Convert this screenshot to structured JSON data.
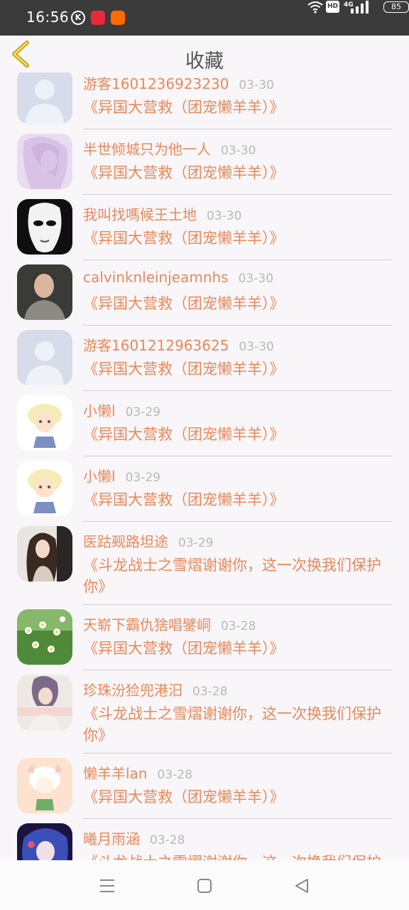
{
  "status_bar": {
    "time": "16:56",
    "battery": "85",
    "hd": "HD",
    "network": "4G"
  },
  "header": {
    "title": "收藏"
  },
  "items": [
    {
      "name": "游客1601236923230",
      "date": "03-30",
      "book": "《异国大营救（团宠懒羊羊）》",
      "avatar": "default"
    },
    {
      "name": "半世倾城只为他一人",
      "date": "03-30",
      "book": "《异国大营救（团宠懒羊羊）》",
      "avatar": "anime-purple"
    },
    {
      "name": "我叫找嗎候王土地",
      "date": "03-30",
      "book": "《异国大营救（团宠懒羊羊）》",
      "avatar": "mask"
    },
    {
      "name": "calvinknleinjeamnhs",
      "date": "03-30",
      "book": "《异国大营救（团宠懒羊羊）》",
      "avatar": "boy"
    },
    {
      "name": "游客1601212963625",
      "date": "03-30",
      "book": "《异国大营救（团宠懒羊羊）》",
      "avatar": "default"
    },
    {
      "name": "小懒l",
      "date": "03-29",
      "book": "《异国大营救（团宠懒羊羊）》",
      "avatar": "sheep"
    },
    {
      "name": "小懒l",
      "date": "03-29",
      "book": "《异国大营救（团宠懒羊羊）》",
      "avatar": "sheep"
    },
    {
      "name": "医跍觋路坦途",
      "date": "03-29",
      "book": "《斗龙战士之雪熠谢谢你，这一次换我们保护你》",
      "avatar": "girl"
    },
    {
      "name": "天崭下霸仇猞唱鐾峒",
      "date": "03-28",
      "book": "《异国大营救（团宠懒羊羊）》",
      "avatar": "flowers"
    },
    {
      "name": "珍珠汾猃兜港汨",
      "date": "03-28",
      "book": "《斗龙战士之雪熠谢谢你，这一次换我们保护你》",
      "avatar": "purple-hair"
    },
    {
      "name": "懒羊羊lan",
      "date": "03-28",
      "book": "《异国大营救（团宠懒羊羊）》",
      "avatar": "anime-sheep"
    },
    {
      "name": "曦月雨涵",
      "date": "03-28",
      "book": "《斗龙战士之雪熠谢谢你，这一次换我们保护你》",
      "avatar": "anime-blue"
    }
  ],
  "icons": {
    "back": "chevron-left-icon",
    "nav_menu": "menu-icon",
    "nav_home": "square-icon",
    "nav_back": "triangle-back-icon"
  },
  "colors": {
    "accent": "#e7895c",
    "back_icon": "#c9a917",
    "date": "#b9b9b9",
    "status_bar": "#3b3b3b"
  }
}
